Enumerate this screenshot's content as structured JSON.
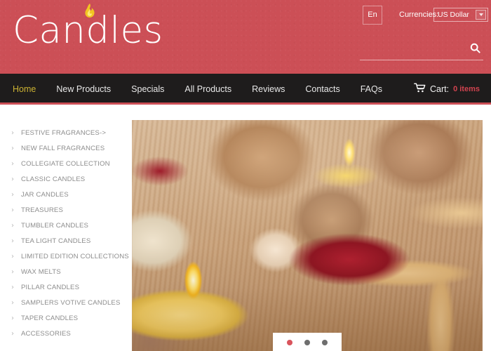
{
  "header": {
    "logo_text": "Candles",
    "flame_icon": "flame-icon",
    "language_label": "En",
    "currency_label": "Currencies:",
    "currency_value": "US Dollar",
    "currency_options": [
      "US Dollar"
    ],
    "search_placeholder": "",
    "search_value": "",
    "search_icon": "search-icon",
    "bg_color": "#cc4f56"
  },
  "nav": {
    "items": [
      {
        "label": "Home",
        "active": true
      },
      {
        "label": "New Products",
        "active": false
      },
      {
        "label": "Specials",
        "active": false
      },
      {
        "label": "All Products",
        "active": false
      },
      {
        "label": "Reviews",
        "active": false
      },
      {
        "label": "Contacts",
        "active": false
      },
      {
        "label": "FAQs",
        "active": false
      }
    ],
    "cart_icon": "shopping-cart-icon",
    "cart_label": "Cart:",
    "cart_count": "0 items",
    "bg_color": "#1e1c1c",
    "active_color": "#ccb233",
    "accent_color": "#cc4f56"
  },
  "sidebar": {
    "arrow_glyph": "›",
    "items": [
      {
        "label": "FESTIVE FRAGRANCES->"
      },
      {
        "label": "NEW FALL FRAGRANCES"
      },
      {
        "label": "COLLEGIATE COLLECTION"
      },
      {
        "label": "CLASSIC CANDLES"
      },
      {
        "label": "JAR CANDLES"
      },
      {
        "label": "TREASURES"
      },
      {
        "label": "TUMBLER CANDLES"
      },
      {
        "label": "TEA LIGHT CANDLES"
      },
      {
        "label": "LIMITED EDITION COLLECTIONS"
      },
      {
        "label": "WAX MELTS"
      },
      {
        "label": "PILLAR CANDLES"
      },
      {
        "label": "SAMPLERS VOTIVE CANDLES"
      },
      {
        "label": "TAPER CANDLES"
      },
      {
        "label": "ACCESSORIES"
      }
    ]
  },
  "slider": {
    "image_alt": "Lit candles with stones, starfish and red rose petals",
    "dots": [
      {
        "active": true
      },
      {
        "active": false
      },
      {
        "active": false
      }
    ],
    "active_dot_color": "#d9545c",
    "inactive_dot_color": "#6e6e6e"
  }
}
